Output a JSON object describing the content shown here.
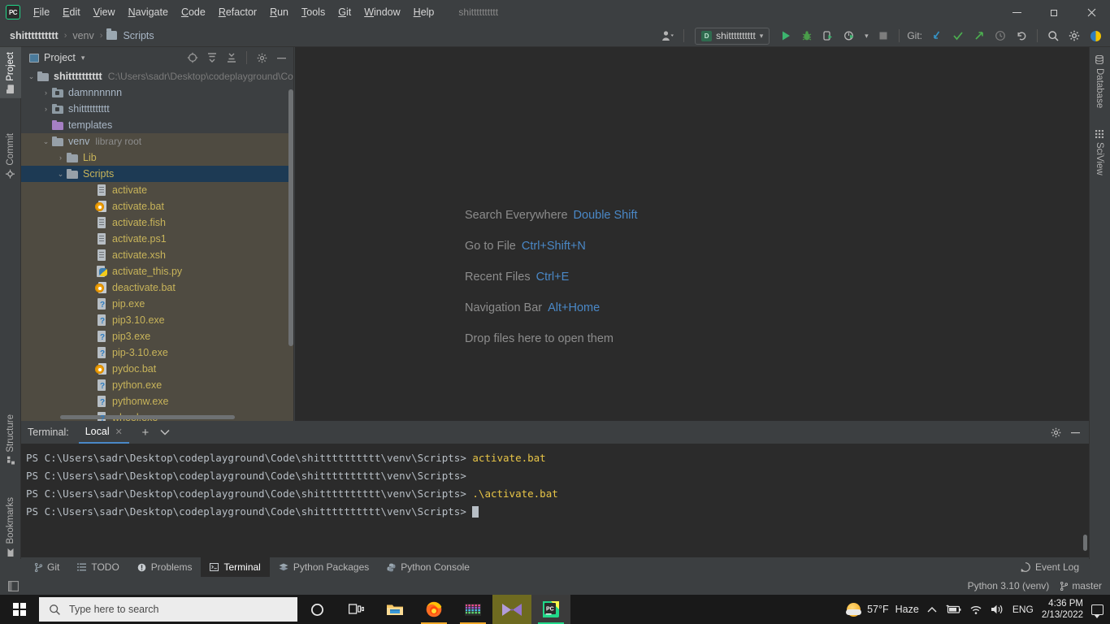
{
  "window": {
    "title": "shitttttttttt",
    "logo_text": "PC",
    "minimize": "—",
    "maximize": "❐",
    "close": "✕"
  },
  "menu": {
    "items": [
      {
        "label": "File"
      },
      {
        "label": "Edit"
      },
      {
        "label": "View"
      },
      {
        "label": "Navigate"
      },
      {
        "label": "Code"
      },
      {
        "label": "Refactor"
      },
      {
        "label": "Run"
      },
      {
        "label": "Tools"
      },
      {
        "label": "Git"
      },
      {
        "label": "Window"
      },
      {
        "label": "Help"
      }
    ]
  },
  "breadcrumb": {
    "items": [
      {
        "label": "shitttttttttt",
        "style": "bold"
      },
      {
        "label": "venv",
        "style": "dim"
      },
      {
        "label": "Scripts",
        "style": "plain"
      }
    ],
    "separator": "›"
  },
  "toolbar": {
    "profile_icon": "user-profile-icon",
    "run_config": "shitttttttttt",
    "run_config_badge": "D",
    "dropdown_caret": "▾",
    "run_label": "run-button",
    "debug_label": "debug-button",
    "coverage_label": "run-coverage-button",
    "profile_label": "profile-button",
    "stop_label": "stop-button",
    "git_label": "Git:",
    "git_update": "update-project-icon",
    "git_commit": "commit-icon",
    "git_push": "push-icon",
    "git_history": "history-icon",
    "git_rollback": "rollback-icon",
    "search_icon": "search-icon",
    "settings_icon": "settings-icon",
    "assistant_icon": "ide-assistant-icon"
  },
  "left_strip": {
    "tabs": [
      {
        "label": "Project",
        "icon": "project-icon",
        "active": true
      },
      {
        "label": "Commit",
        "icon": "commit-icon",
        "active": false
      },
      {
        "label": "Structure",
        "icon": "structure-icon",
        "active": false
      },
      {
        "label": "Bookmarks",
        "icon": "bookmarks-icon",
        "active": false
      }
    ]
  },
  "right_strip": {
    "tabs": [
      {
        "label": "Database",
        "icon": "database-icon"
      },
      {
        "label": "SciView",
        "icon": "sciview-icon"
      }
    ]
  },
  "project_panel": {
    "title": "Project",
    "chevron": "▾",
    "actions": [
      {
        "name": "select-opened-file-icon",
        "glyph": "⊕"
      },
      {
        "name": "expand-all-icon",
        "glyph": "⤓"
      },
      {
        "name": "collapse-all-icon",
        "glyph": "⤒"
      },
      {
        "name": "settings-icon",
        "glyph": "⚙"
      },
      {
        "name": "hide-icon",
        "glyph": "—"
      }
    ],
    "tree": [
      {
        "indent": 0,
        "arrow": "⌄",
        "icon": "folder",
        "label": "shitttttttttt",
        "style": "bold",
        "path": "C:\\Users\\sadr\\Desktop\\codeplayground\\Co",
        "state": "normal"
      },
      {
        "indent": 1,
        "arrow": "›",
        "icon": "folder-module",
        "label": "damnnnnnn",
        "style": "plain",
        "path": "",
        "state": "normal"
      },
      {
        "indent": 1,
        "arrow": "›",
        "icon": "folder-module",
        "label": "shitttttttttt",
        "style": "plain",
        "path": "",
        "state": "normal"
      },
      {
        "indent": 1,
        "arrow": "",
        "icon": "folder-purple",
        "label": "templates",
        "style": "plain",
        "path": "",
        "state": "normal"
      },
      {
        "indent": 1,
        "arrow": "⌄",
        "icon": "folder",
        "label": "venv",
        "style": "plain",
        "tag": "library root",
        "state": "libroot"
      },
      {
        "indent": 2,
        "arrow": "›",
        "icon": "folder",
        "label": "Lib",
        "style": "yellow",
        "path": "",
        "state": "libroot"
      },
      {
        "indent": 2,
        "arrow": "⌄",
        "icon": "folder",
        "label": "Scripts",
        "style": "yellow",
        "path": "",
        "state": "selected"
      },
      {
        "indent": 4,
        "arrow": "",
        "icon": "file",
        "label": "activate",
        "style": "yellow",
        "path": "",
        "state": "libroot"
      },
      {
        "indent": 4,
        "arrow": "",
        "icon": "bat",
        "label": "activate.bat",
        "style": "yellow",
        "path": "",
        "state": "libroot"
      },
      {
        "indent": 4,
        "arrow": "",
        "icon": "file",
        "label": "activate.fish",
        "style": "yellow",
        "path": "",
        "state": "libroot"
      },
      {
        "indent": 4,
        "arrow": "",
        "icon": "file",
        "label": "activate.ps1",
        "style": "yellow",
        "path": "",
        "state": "libroot"
      },
      {
        "indent": 4,
        "arrow": "",
        "icon": "file",
        "label": "activate.xsh",
        "style": "yellow",
        "path": "",
        "state": "libroot"
      },
      {
        "indent": 4,
        "arrow": "",
        "icon": "py",
        "label": "activate_this.py",
        "style": "yellow",
        "path": "",
        "state": "libroot"
      },
      {
        "indent": 4,
        "arrow": "",
        "icon": "bat",
        "label": "deactivate.bat",
        "style": "yellow",
        "path": "",
        "state": "libroot"
      },
      {
        "indent": 4,
        "arrow": "",
        "icon": "exe",
        "label": "pip.exe",
        "style": "yellow",
        "path": "",
        "state": "libroot"
      },
      {
        "indent": 4,
        "arrow": "",
        "icon": "exe",
        "label": "pip3.10.exe",
        "style": "yellow",
        "path": "",
        "state": "libroot"
      },
      {
        "indent": 4,
        "arrow": "",
        "icon": "exe",
        "label": "pip3.exe",
        "style": "yellow",
        "path": "",
        "state": "libroot"
      },
      {
        "indent": 4,
        "arrow": "",
        "icon": "exe",
        "label": "pip-3.10.exe",
        "style": "yellow",
        "path": "",
        "state": "libroot"
      },
      {
        "indent": 4,
        "arrow": "",
        "icon": "bat",
        "label": "pydoc.bat",
        "style": "yellow",
        "path": "",
        "state": "libroot"
      },
      {
        "indent": 4,
        "arrow": "",
        "icon": "exe",
        "label": "python.exe",
        "style": "yellow",
        "path": "",
        "state": "libroot"
      },
      {
        "indent": 4,
        "arrow": "",
        "icon": "exe",
        "label": "pythonw.exe",
        "style": "yellow",
        "path": "",
        "state": "libroot"
      },
      {
        "indent": 4,
        "arrow": "",
        "icon": "exe",
        "label": "wheel.exe",
        "style": "yellow",
        "path": "",
        "state": "libroot"
      }
    ]
  },
  "editor": {
    "hints": [
      {
        "action": "Search Everywhere",
        "key": "Double Shift"
      },
      {
        "action": "Go to File",
        "key": "Ctrl+Shift+N"
      },
      {
        "action": "Recent Files",
        "key": "Ctrl+E"
      },
      {
        "action": "Navigation Bar",
        "key": "Alt+Home"
      },
      {
        "action": "Drop files here to open them",
        "key": ""
      }
    ]
  },
  "terminal": {
    "label": "Terminal:",
    "tab": "Local",
    "tab_close": "✕",
    "add": "+",
    "chevron": "⌄",
    "settings_icon": "settings-icon",
    "hide_icon": "—",
    "lines": [
      {
        "prompt": "PS C:\\Users\\sadr\\Desktop\\codeplayground\\Code\\shitttttttttt\\venv\\Scripts>",
        "command": "activate.bat",
        "caret": false
      },
      {
        "prompt": "PS C:\\Users\\sadr\\Desktop\\codeplayground\\Code\\shitttttttttt\\venv\\Scripts>",
        "command": "",
        "caret": false
      },
      {
        "prompt": "PS C:\\Users\\sadr\\Desktop\\codeplayground\\Code\\shitttttttttt\\venv\\Scripts>",
        "command": ".\\activate.bat",
        "caret": false
      },
      {
        "prompt": "PS C:\\Users\\sadr\\Desktop\\codeplayground\\Code\\shitttttttttt\\venv\\Scripts>",
        "command": "",
        "caret": true
      }
    ]
  },
  "bottom_bar": {
    "tabs": [
      {
        "label": "Git",
        "icon": "git-branch-icon",
        "glyph": "⑂",
        "active": false
      },
      {
        "label": "TODO",
        "icon": "todo-list-icon",
        "glyph": "≡",
        "active": false
      },
      {
        "label": "Problems",
        "icon": "problems-icon",
        "glyph": "ⓘ",
        "active": false
      },
      {
        "label": "Terminal",
        "icon": "terminal-icon",
        "glyph": "▣",
        "active": true
      },
      {
        "label": "Python Packages",
        "icon": "python-packages-icon",
        "glyph": "☰",
        "active": false
      },
      {
        "label": "Python Console",
        "icon": "python-console-icon",
        "glyph": "⌘",
        "active": false
      }
    ],
    "event_log": "Event Log",
    "event_log_icon": "event-log-icon"
  },
  "status_bar": {
    "layout_icon": "layout-icon",
    "interpreter": "Python 3.10 (venv)",
    "branch": "master",
    "branch_icon": "git-branch-icon"
  },
  "taskbar": {
    "start": "windows-start-icon",
    "search_placeholder": "Type here to search",
    "search_icon": "search-icon",
    "apps": [
      {
        "name": "cortana-icon",
        "glyph": "○"
      },
      {
        "name": "task-view-icon",
        "glyph": "⌸"
      },
      {
        "name": "file-explorer-icon",
        "glyph": ""
      },
      {
        "name": "firefox-icon",
        "glyph": ""
      },
      {
        "name": "winrar-icon",
        "glyph": ""
      },
      {
        "name": "media-player-icon",
        "glyph": ""
      },
      {
        "name": "pycharm-icon",
        "glyph": "PC"
      }
    ],
    "tray": {
      "weather_temp": "57°F",
      "weather_cond": "Haze",
      "overflow": "∧",
      "battery_icon": "battery-icon",
      "wifi_icon": "wifi-icon",
      "volume_icon": "volume-icon",
      "language": "ENG",
      "time": "4:36 PM",
      "date": "2/13/2022",
      "notifications_icon": "notifications-icon"
    }
  },
  "colors": {
    "accent_blue": "#4a88c7",
    "panel_bg": "#3c3f41",
    "editor_bg": "#2b2b2b",
    "selection": "#1d3a54",
    "libroot": "#4f4b41",
    "file_yellow": "#c8b45a",
    "terminal_cmd": "#e8c547",
    "green": "#21d789"
  }
}
